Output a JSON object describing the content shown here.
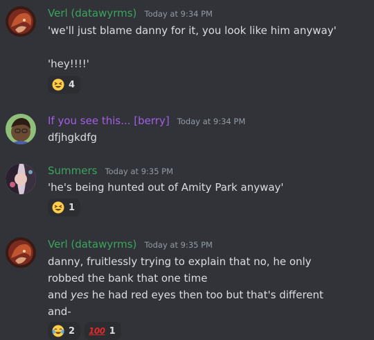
{
  "messages": [
    {
      "author": "Verl (datawyrms)",
      "author_color": "#3ba55d",
      "timestamp": "Today at 9:34 PM",
      "lines": [
        "'we'll just blame danny for it, you look like him anyway'",
        "'hey!!!!'"
      ],
      "reactions": [
        {
          "emoji": "grinning-squinting-face",
          "count": "4"
        }
      ]
    },
    {
      "author": "If you see this... [berry]",
      "author_color": "#a260e6",
      "timestamp": "Today at 9:34 PM",
      "lines": [
        "dfjhgkdfg"
      ]
    },
    {
      "author": "Summers",
      "author_color": "#3ba55d",
      "timestamp": "Today at 9:35 PM",
      "lines": [
        "'he's being hunted out of Amity Park anyway'"
      ],
      "reactions": [
        {
          "emoji": "grinning-squinting-face",
          "count": "1"
        }
      ]
    },
    {
      "author": "Verl (datawyrms)",
      "author_color": "#3ba55d",
      "timestamp": "Today at 9:35 PM",
      "lines": [
        "danny, fruitlessly trying to explain that no, he only",
        "robbed the bank that one time",
        "and ",
        "yes",
        " he had red eyes then too but that's different",
        "and-"
      ],
      "reactions": [
        {
          "emoji": "face-with-tears-of-joy",
          "count": "2"
        },
        {
          "emoji": "hundred-points",
          "label": "100",
          "count": "1"
        }
      ]
    }
  ]
}
